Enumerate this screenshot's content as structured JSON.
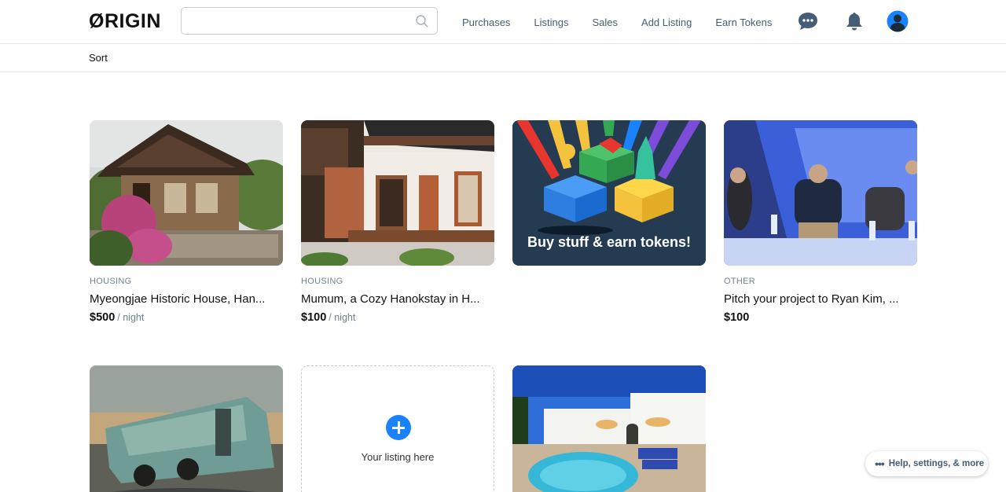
{
  "header": {
    "logo": "ØRIGIN",
    "search": {
      "placeholder": "",
      "value": ""
    },
    "links": [
      "Purchases",
      "Listings",
      "Sales",
      "Add Listing",
      "Earn Tokens"
    ],
    "icons": [
      "chat-icon",
      "bell-icon",
      "avatar"
    ]
  },
  "subbar": {
    "sort_label": "Sort"
  },
  "listings": [
    {
      "category": "HOUSING",
      "title": "Myeongjae Historic House, Han...",
      "price": "$500",
      "unit": "/ night"
    },
    {
      "category": "HOUSING",
      "title": "Mumum, a Cozy Hanokstay in H...",
      "price": "$100",
      "unit": "/ night"
    },
    {
      "banner": "Buy stuff & earn tokens!"
    },
    {
      "category": "OTHER",
      "title": "Pitch your project to Ryan Kim, ...",
      "price": "$100",
      "unit": ""
    }
  ],
  "placeholder": {
    "label": "Your listing here"
  },
  "help": {
    "label": "Help, settings, & more"
  },
  "colors": {
    "accent": "#1a82ff",
    "nav_text": "#455d75",
    "banner_bg": "#253b52"
  }
}
